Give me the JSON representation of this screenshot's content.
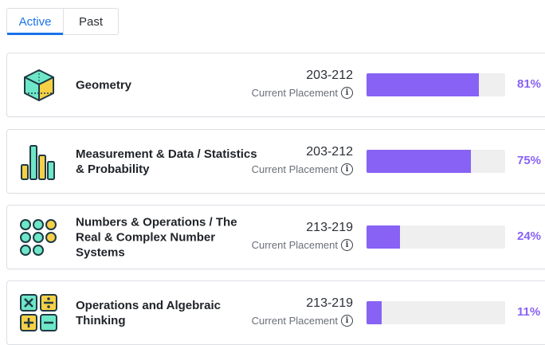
{
  "tabs": [
    {
      "label": "Active",
      "active": true
    },
    {
      "label": "Past",
      "active": false
    }
  ],
  "placement_label": "Current Placement",
  "domains": [
    {
      "name": "Geometry",
      "range": "203-212",
      "percent_label": "81%",
      "progress": 0.81,
      "icon": "cube-icon"
    },
    {
      "name": "Measurement & Data / Statistics & Probability",
      "range": "203-212",
      "percent_label": "75%",
      "progress": 0.75,
      "icon": "bar-chart-icon"
    },
    {
      "name": "Numbers & Operations / The Real & Complex Number Systems",
      "range": "213-219",
      "percent_label": "24%",
      "progress": 0.24,
      "icon": "number-dots-icon"
    },
    {
      "name": "Operations and Algebraic Thinking",
      "range": "213-219",
      "percent_label": "11%",
      "progress": 0.11,
      "icon": "operations-icon"
    }
  ],
  "colors": {
    "accent": "#1a73e8",
    "progress": "#8862f4",
    "track": "#efefef",
    "icon_teal": "#6ee7c8",
    "icon_yellow": "#f7d046",
    "icon_outline": "#1f3a44"
  }
}
